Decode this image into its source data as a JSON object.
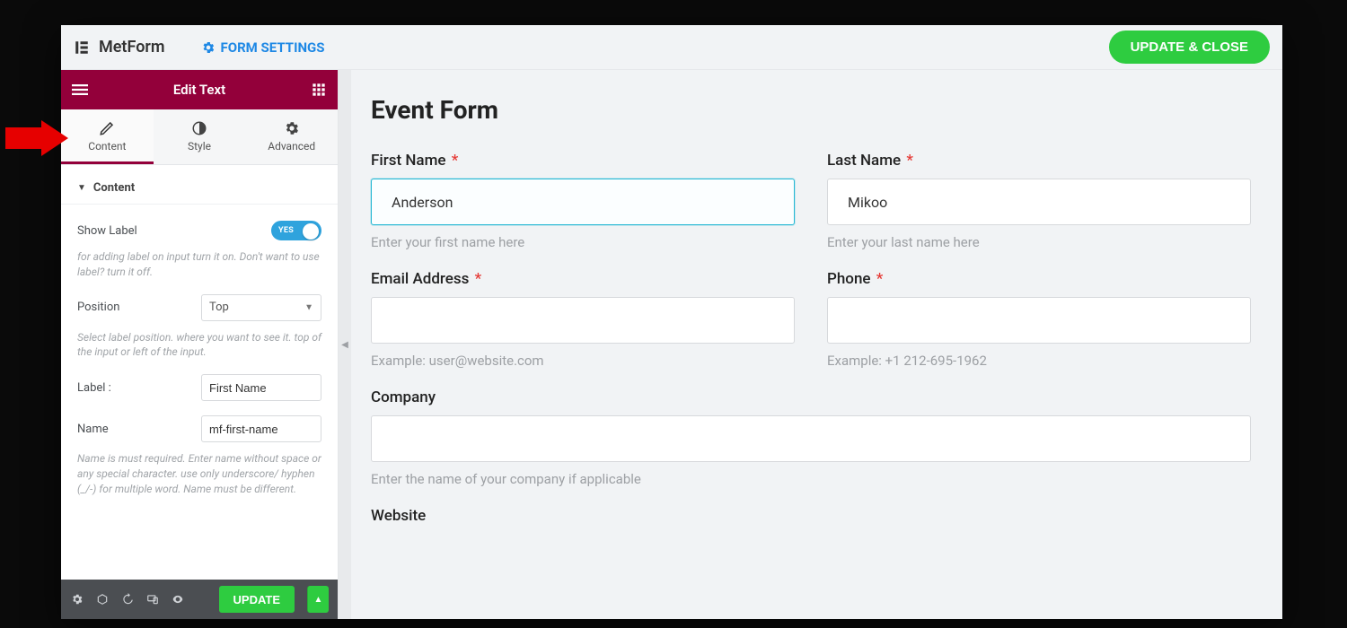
{
  "header": {
    "brand": "MetForm",
    "form_settings": "FORM SETTINGS",
    "update_close": "UPDATE & CLOSE"
  },
  "editor": {
    "title": "Edit Text",
    "tabs": {
      "content": "Content",
      "style": "Style",
      "advanced": "Advanced"
    },
    "section_head": "Content",
    "show_label": {
      "label": "Show Label",
      "state": "YES",
      "hint": "for adding label on input turn it on. Don't want to use label? turn it off."
    },
    "position": {
      "label": "Position",
      "value": "Top",
      "hint": "Select label position. where you want to see it. top of the input or left of the input."
    },
    "label_field": {
      "label": "Label :",
      "value": "First Name"
    },
    "name_field": {
      "label": "Name",
      "value": "mf-first-name",
      "hint": "Name is must required. Enter name without space or any special character. use only underscore/ hyphen (_/-) for multiple word. Name must be different."
    },
    "footer": {
      "update": "UPDATE"
    }
  },
  "preview": {
    "title": "Event Form",
    "fields": {
      "first_name": {
        "label": "First Name",
        "placeholder": "Anderson",
        "helper": "Enter your first name here",
        "required": true
      },
      "last_name": {
        "label": "Last Name",
        "placeholder": "Mikoo",
        "helper": "Enter your last name here",
        "required": true
      },
      "email": {
        "label": "Email Address",
        "helper": "Example: user@website.com",
        "required": true
      },
      "phone": {
        "label": "Phone",
        "helper": "Example: +1 212-695-1962",
        "required": true
      },
      "company": {
        "label": "Company",
        "helper": "Enter the name of your company if applicable",
        "required": false
      },
      "website": {
        "label": "Website",
        "required": false
      }
    }
  }
}
